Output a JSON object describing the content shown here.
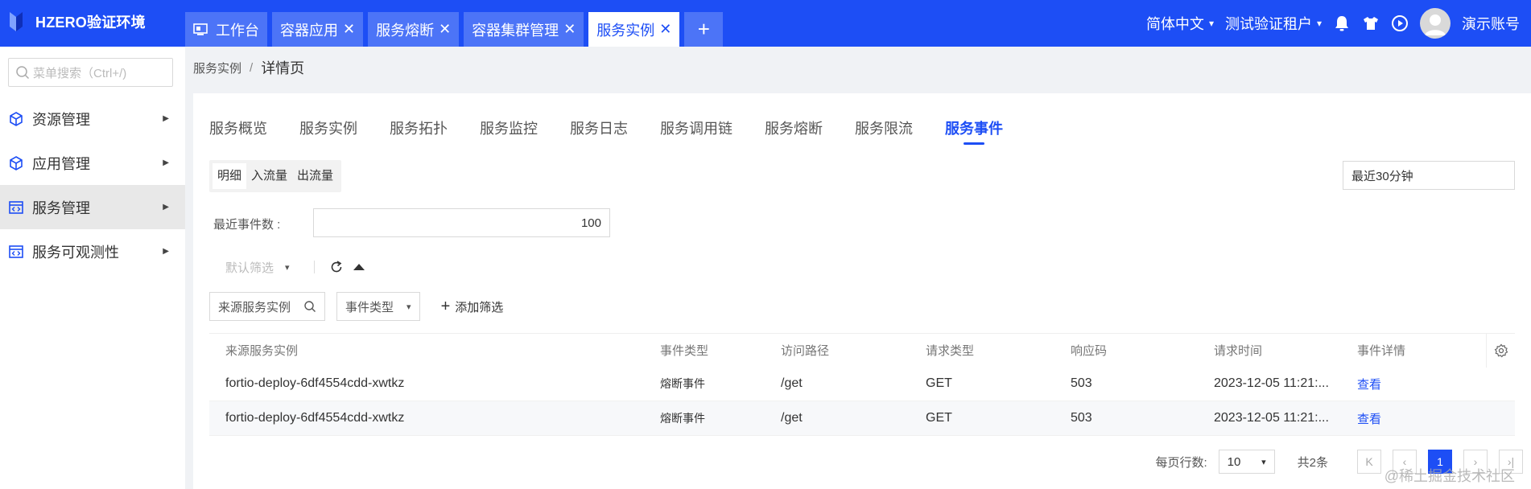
{
  "app": {
    "title": "HZERO验证环境"
  },
  "tabs": [
    {
      "label": "工作台",
      "icon": "monitor-icon",
      "closable": false,
      "active": false
    },
    {
      "label": "容器应用",
      "closable": true,
      "active": false
    },
    {
      "label": "服务熔断",
      "closable": true,
      "active": false
    },
    {
      "label": "容器集群管理",
      "closable": true,
      "active": false
    },
    {
      "label": "服务实例",
      "closable": true,
      "active": true
    }
  ],
  "tab_close_glyph": "✕",
  "tab_add_glyph": "+",
  "header": {
    "language": "简体中文",
    "tenant": "测试验证租户",
    "account": "演示账号"
  },
  "sidebar": {
    "search_placeholder": "菜单搜索（Ctrl+/)",
    "items": [
      {
        "label": "资源管理",
        "icon": "cube-icon",
        "active": false
      },
      {
        "label": "应用管理",
        "icon": "cube-icon",
        "active": false
      },
      {
        "label": "服务管理",
        "icon": "code-window-icon",
        "active": true
      },
      {
        "label": "服务可观测性",
        "icon": "code-window-icon",
        "active": false
      }
    ]
  },
  "breadcrumb": {
    "parent": "服务实例",
    "sep": "/",
    "current": "详情页"
  },
  "subtabs": [
    {
      "label": "服务概览",
      "active": false
    },
    {
      "label": "服务实例",
      "active": false
    },
    {
      "label": "服务拓扑",
      "active": false
    },
    {
      "label": "服务监控",
      "active": false
    },
    {
      "label": "服务日志",
      "active": false
    },
    {
      "label": "服务调用链",
      "active": false
    },
    {
      "label": "服务熔断",
      "active": false
    },
    {
      "label": "服务限流",
      "active": false
    },
    {
      "label": "服务事件",
      "active": true
    }
  ],
  "segment": [
    {
      "label": "明细",
      "active": true
    },
    {
      "label": "入流量",
      "active": false
    },
    {
      "label": "出流量",
      "active": false
    }
  ],
  "time_range": "最近30分钟",
  "event_count": {
    "label": "最近事件数 :",
    "value": "100"
  },
  "filterbar": {
    "default_filter": "默认筛选"
  },
  "filters": {
    "source_instance_placeholder": "来源服务实例",
    "event_type": "事件类型",
    "add_filter": "添加筛选"
  },
  "table": {
    "columns": [
      "来源服务实例",
      "事件类型",
      "访问路径",
      "请求类型",
      "响应码",
      "请求时间",
      "事件详情"
    ],
    "rows": [
      {
        "source": "fortio-deploy-6df4554cdd-xwtkz",
        "type": "熔断事件",
        "path": "/get",
        "method": "GET",
        "code": "503",
        "time": "2023-12-05 11:21:...",
        "detail": "查看"
      },
      {
        "source": "fortio-deploy-6df4554cdd-xwtkz",
        "type": "熔断事件",
        "path": "/get",
        "method": "GET",
        "code": "503",
        "time": "2023-12-05 11:21:...",
        "detail": "查看"
      }
    ]
  },
  "pager": {
    "page_size_label": "每页行数:",
    "page_size": "10",
    "total": "共2条",
    "current_page": "1"
  },
  "watermark": "@稀土掘金技术社区",
  "colors": {
    "primary": "#1d4ef5",
    "tab_inactive": "#4c74f7"
  }
}
